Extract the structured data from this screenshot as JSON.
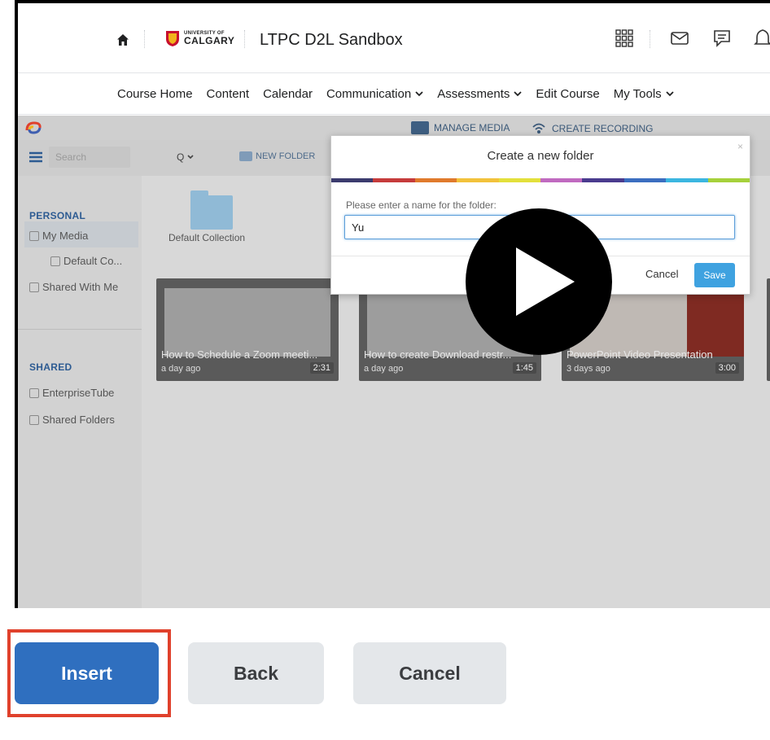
{
  "header": {
    "logo_small": "UNIVERSITY OF",
    "logo_big": "CALGARY",
    "course_title": "LTPC D2L Sandbox"
  },
  "nav": {
    "items": [
      {
        "label": "Course Home",
        "dropdown": false
      },
      {
        "label": "Content",
        "dropdown": false
      },
      {
        "label": "Calendar",
        "dropdown": false
      },
      {
        "label": "Communication",
        "dropdown": true
      },
      {
        "label": "Assessments",
        "dropdown": true
      },
      {
        "label": "Edit Course",
        "dropdown": false
      },
      {
        "label": "My Tools",
        "dropdown": true
      }
    ]
  },
  "kaltura": {
    "manage_media": "MANAGE MEDIA",
    "create_recording": "CREATE RECORDING",
    "search_placeholder": "Search",
    "search_dropdown": "Q",
    "new_folder": "NEW FOLDER",
    "sidebar": {
      "personal_heading": "PERSONAL",
      "my_media": "My Media",
      "default_collection_short": "Default Co...",
      "shared_with_me": "Shared With Me",
      "shared_heading": "SHARED",
      "enterprise_tube": "EnterpriseTube",
      "shared_folders": "Shared Folders"
    },
    "folder_label": "Default Collection",
    "videos": [
      {
        "title": "How to Schedule a Zoom meeti...",
        "age": "a day ago",
        "duration": "2:31"
      },
      {
        "title": "How to create Download restr...",
        "age": "a day ago",
        "duration": "1:45"
      },
      {
        "title": "PowerPoint Video Presentation",
        "age": "3 days ago",
        "duration": "3:00"
      }
    ]
  },
  "modal": {
    "title": "Create a new folder",
    "close": "×",
    "label": "Please enter a name for the folder:",
    "input_value": "Yu",
    "cancel": "Cancel",
    "save": "Save",
    "rainbow_colors": [
      "#3b3b6e",
      "#c63b3b",
      "#e07a2c",
      "#f2c23b",
      "#e3e03b",
      "#c06ac0",
      "#4a3b8e",
      "#3b6ec0",
      "#3bb6e0",
      "#a6d13b"
    ]
  },
  "buttons": {
    "insert": "Insert",
    "back": "Back",
    "cancel": "Cancel"
  },
  "colors": {
    "insert_bg": "#2f6fbf",
    "highlight": "#e0412c",
    "secondary_bg": "#e4e7ea"
  }
}
